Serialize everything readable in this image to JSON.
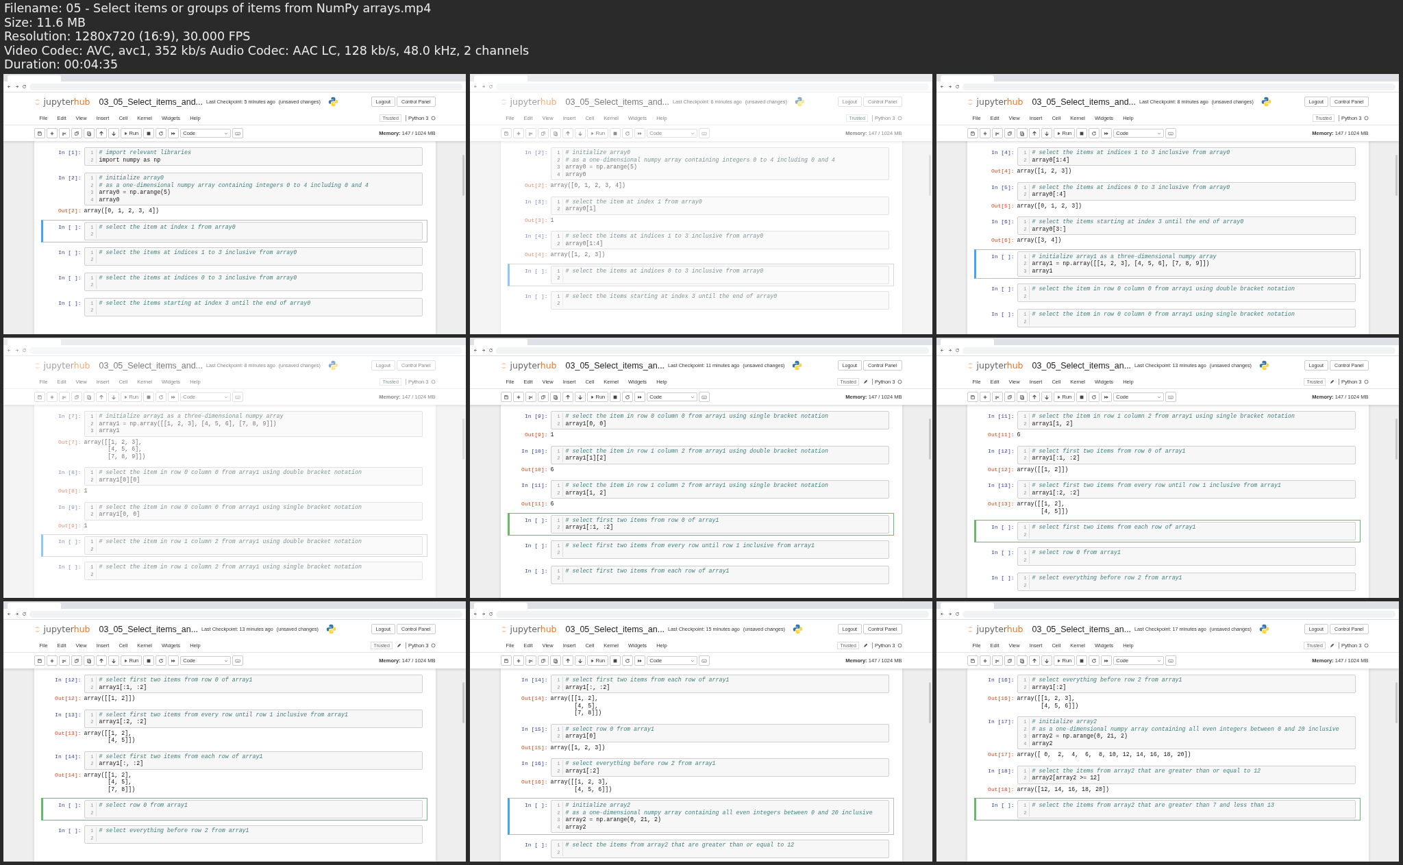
{
  "file_info": [
    "Filename: 05 - Select items or groups of items from NumPy arrays.mp4",
    "Size: 11.6 MB",
    "Resolution: 1280x720 (16:9), 30.000 FPS",
    "Video Codec: AVC, avc1, 352 kb/s Audio Codec: AAC LC, 128 kb/s, 48.0 kHz, 2 channels",
    "Duration: 00:04:35"
  ],
  "frames": [
    {
      "faded": false,
      "notebook_title": "03_05_Select_items_and...",
      "checkpoint": "Last Checkpoint: 5 minutes ago",
      "unsaved": "(unsaved changes)",
      "brand": [
        "jupyter",
        "hub"
      ],
      "buttons": [
        "Logout",
        "Control Panel"
      ],
      "menus": [
        "File",
        "Edit",
        "View",
        "Insert",
        "Cell",
        "Kernel",
        "Widgets",
        "Help"
      ],
      "trusted": "Trusted",
      "pencil": false,
      "kernel": "Python 3",
      "run": "Run",
      "cell_type": "Code",
      "memory": "**Memory:** 147 / 1024 MB",
      "cells": [
        {
          "prompt": "In [1]:",
          "line_numbers": [
            "1",
            "2"
          ],
          "lines": [
            "# import relevant libraries",
            "import numpy as np"
          ],
          "selected": false
        },
        {
          "prompt": "In [2]:",
          "line_numbers": [
            "1",
            "2",
            "3",
            "4"
          ],
          "lines": [
            "# initialize array0",
            "# as a one-dimensional numpy array containing integers 0 to 4 including 0 and 4",
            "array0 = np.arange(5)",
            "array0"
          ],
          "out_prompt": "Out[2]:",
          "output": [
            "array([0, 1, 2, 3, 4])"
          ],
          "selected": false
        },
        {
          "prompt": "In [ ]:",
          "line_numbers": [
            "1",
            "2"
          ],
          "lines": [
            "# select the item at index 1 from array0"
          ],
          "selected": true,
          "editing": false
        },
        {
          "prompt": "In [ ]:",
          "line_numbers": [
            "1",
            "2"
          ],
          "lines": [
            "# select the items at indices 1 to 3 inclusive from array0"
          ],
          "selected": false
        },
        {
          "prompt": "In [ ]:",
          "line_numbers": [
            "1",
            "2"
          ],
          "lines": [
            "# select the items at indices 0 to 3 inclusive from array0"
          ],
          "selected": false
        },
        {
          "prompt": "In [ ]:",
          "line_numbers": [
            "1",
            "2"
          ],
          "lines": [
            "# select the items starting at index 3 until the end of array0"
          ],
          "selected": false
        }
      ]
    },
    {
      "faded": true,
      "notebook_title": "03_05_Select_items_and...",
      "checkpoint": "Last Checkpoint: 6 minutes ago",
      "unsaved": "(unsaved changes)",
      "brand": [
        "jupyter",
        "hub"
      ],
      "buttons": [
        "Logout",
        "Control Panel"
      ],
      "menus": [
        "File",
        "Edit",
        "View",
        "Insert",
        "Cell",
        "Kernel",
        "Widgets",
        "Help"
      ],
      "trusted": "Trusted",
      "pencil": false,
      "kernel": "Python 3",
      "run": "Run",
      "cell_type": "Code",
      "memory": "**Memory:** 147 / 1024 MB",
      "cells": [
        {
          "prompt": "In [2]:",
          "line_numbers": [
            "1",
            "2",
            "3",
            "4"
          ],
          "lines": [
            "# initialize array0",
            "# as a one-dimensional numpy array containing integers 0 to 4 including 0 and 4",
            "array0 = np.arange(5)",
            "array0"
          ],
          "out_prompt": "Out[2]:",
          "output": [
            "array([0, 1, 2, 3, 4])"
          ],
          "selected": false
        },
        {
          "prompt": "In [3]:",
          "line_numbers": [
            "1",
            "2"
          ],
          "lines": [
            "# select the item at index 1 from array0",
            "array0[1]"
          ],
          "out_prompt": "Out[3]:",
          "output": [
            "1"
          ],
          "selected": false
        },
        {
          "prompt": "In [4]:",
          "line_numbers": [
            "1",
            "2"
          ],
          "lines": [
            "# select the items at indices 1 to 3 inclusive from array0",
            "array0[1:4]"
          ],
          "out_prompt": "Out[4]:",
          "output": [
            "array([1, 2, 3])"
          ],
          "selected": false
        },
        {
          "prompt": "In [ ]:",
          "line_numbers": [
            "1",
            "2"
          ],
          "lines": [
            "# select the items at indices 0 to 3 inclusive from array0"
          ],
          "selected": true,
          "editing": false
        },
        {
          "prompt": "In [ ]:",
          "line_numbers": [
            "1",
            "2"
          ],
          "lines": [
            "# select the items starting at index 3 until the end of array0"
          ],
          "selected": false
        }
      ]
    },
    {
      "faded": false,
      "notebook_title": "03_05_Select_items_and...",
      "checkpoint": "Last Checkpoint: 8 minutes ago",
      "unsaved": "(unsaved changes)",
      "brand": [
        "jupyter",
        "hub"
      ],
      "buttons": [
        "Logout",
        "Control Panel"
      ],
      "menus": [
        "File",
        "Edit",
        "View",
        "Insert",
        "Cell",
        "Kernel",
        "Widgets",
        "Help"
      ],
      "trusted": "Trusted",
      "pencil": false,
      "kernel": "Python 3",
      "run": "Run",
      "cell_type": "Code",
      "memory": "**Memory:** 147 / 1024 MB",
      "cells": [
        {
          "prompt": "In [4]:",
          "line_numbers": [
            "1",
            "2"
          ],
          "lines": [
            "# select the items at indices 1 to 3 inclusive from array0",
            "array0[1:4]"
          ],
          "out_prompt": "Out[4]:",
          "output": [
            "array([1, 2, 3])"
          ],
          "selected": false
        },
        {
          "prompt": "In [5]:",
          "line_numbers": [
            "1",
            "2"
          ],
          "lines": [
            "# select the items at indices 0 to 3 inclusive from array0",
            "array0[:4]"
          ],
          "out_prompt": "Out[5]:",
          "output": [
            "array([0, 1, 2, 3])"
          ],
          "selected": false
        },
        {
          "prompt": "In [6]:",
          "line_numbers": [
            "1",
            "2"
          ],
          "lines": [
            "# select the items starting at index 3 until the end of array0",
            "array0[3:]"
          ],
          "out_prompt": "Out[6]:",
          "output": [
            "array([3, 4])"
          ],
          "selected": false
        },
        {
          "prompt": "In [ ]:",
          "line_numbers": [
            "1",
            "2",
            "3"
          ],
          "lines": [
            "# initialize array1 as a three-dimensional numpy array",
            "array1 = np.array([[1, 2, 3], [4, 5, 6], [7, 8, 9]])",
            "array1"
          ],
          "selected": true,
          "editing": false
        },
        {
          "prompt": "In [ ]:",
          "line_numbers": [
            "1",
            "2"
          ],
          "lines": [
            "# select the item in row 0 column 0 from array1 using double bracket notation"
          ],
          "selected": false
        },
        {
          "prompt": "In [ ]:",
          "line_numbers": [
            "1",
            "2"
          ],
          "lines": [
            "# select the item in row 0 column 0 from array1 using single bracket notation"
          ],
          "selected": false
        }
      ]
    },
    {
      "faded": true,
      "notebook_title": "03_05_Select_items_and...",
      "checkpoint": "Last Checkpoint: 8 minutes ago",
      "unsaved": "(unsaved changes)",
      "brand": [
        "jupyter",
        "hub"
      ],
      "buttons": [
        "Logout",
        "Control Panel"
      ],
      "menus": [
        "File",
        "Edit",
        "View",
        "Insert",
        "Cell",
        "Kernel",
        "Widgets",
        "Help"
      ],
      "trusted": "Trusted",
      "pencil": false,
      "kernel": "Python 3",
      "run": "Run",
      "cell_type": "Code",
      "memory": "**Memory:** 147 / 1024 MB",
      "cells": [
        {
          "prompt": "In [7]:",
          "line_numbers": [
            "1",
            "2",
            "3"
          ],
          "lines": [
            "# initialize array1 as a three-dimensional numpy array",
            "array1 = np.array([[1, 2, 3], [4, 5, 6], [7, 8, 9]])",
            "array1"
          ],
          "out_prompt": "Out[7]:",
          "output": [
            "array([[1, 2, 3],",
            "       [4, 5, 6],",
            "       [7, 8, 9]])"
          ],
          "selected": false
        },
        {
          "prompt": "In [8]:",
          "line_numbers": [
            "1",
            "2"
          ],
          "lines": [
            "# select the item in row 0 column 0 from array1 using double bracket notation",
            "array1[0][0]"
          ],
          "out_prompt": "Out[8]:",
          "output": [
            "1"
          ],
          "selected": false
        },
        {
          "prompt": "In [9]:",
          "line_numbers": [
            "1",
            "2"
          ],
          "lines": [
            "# select the item in row 0 column 0 from array1 using single bracket notation",
            "array1[0, 0]"
          ],
          "out_prompt": "Out[9]:",
          "output": [
            "1"
          ],
          "selected": false
        },
        {
          "prompt": "In [ ]:",
          "line_numbers": [
            "1",
            "2"
          ],
          "lines": [
            "# select the item in row 1 column 2 from array1 using double bracket notation"
          ],
          "selected": true,
          "editing": false
        },
        {
          "prompt": "In [ ]:",
          "line_numbers": [
            "1",
            "2"
          ],
          "lines": [
            "# select the item in row 1 column 2 from array1 using single bracket notation"
          ],
          "selected": false
        }
      ]
    },
    {
      "faded": false,
      "notebook_title": "03_05_Select_items_an...",
      "checkpoint": "Last Checkpoint: 11 minutes ago",
      "unsaved": "(unsaved changes)",
      "brand": [
        "jupyter",
        "hub"
      ],
      "buttons": [
        "Logout",
        "Control Panel"
      ],
      "menus": [
        "File",
        "Edit",
        "View",
        "Insert",
        "Cell",
        "Kernel",
        "Widgets",
        "Help"
      ],
      "trusted": "Trusted",
      "pencil": true,
      "kernel": "Python 3",
      "run": "Run",
      "cell_type": "Code",
      "memory": "**Memory:** 147 / 1024 MB",
      "cells": [
        {
          "prompt": "In [9]:",
          "line_numbers": [
            "1",
            "2"
          ],
          "lines": [
            "# select the item in row 0 column 0 from array1 using single bracket notation",
            "array1[0, 0]"
          ],
          "out_prompt": "Out[9]:",
          "output": [
            "1"
          ],
          "selected": false
        },
        {
          "prompt": "In [10]:",
          "line_numbers": [
            "1",
            "2"
          ],
          "lines": [
            "# select the item in row 1 column 2 from array1 using double bracket notation",
            "array1[1][2]"
          ],
          "out_prompt": "Out[10]:",
          "output": [
            "6"
          ],
          "selected": false
        },
        {
          "prompt": "In [11]:",
          "line_numbers": [
            "1",
            "2"
          ],
          "lines": [
            "# select the item in row 1 column 2 from array1 using single bracket notation",
            "array1[1, 2]"
          ],
          "out_prompt": "Out[11]:",
          "output": [
            "6"
          ],
          "selected": false
        },
        {
          "prompt": "In [ ]:",
          "line_numbers": [
            "1",
            "2"
          ],
          "lines": [
            "# select first two items from row 0 of array1",
            "array1[:1, :2]"
          ],
          "selected": true,
          "editing": true
        },
        {
          "prompt": "In [ ]:",
          "line_numbers": [
            "1",
            "2"
          ],
          "lines": [
            "# select first two items from every row until row 1 inclusive from array1"
          ],
          "selected": false
        },
        {
          "prompt": "In [ ]:",
          "line_numbers": [
            "1",
            "2"
          ],
          "lines": [
            "# select first two items from each row of array1"
          ],
          "selected": false
        }
      ]
    },
    {
      "faded": false,
      "notebook_title": "03_05_Select_items_an...",
      "checkpoint": "Last Checkpoint: 13 minutes ago",
      "unsaved": "(unsaved changes)",
      "brand": [
        "jupyter",
        "hub"
      ],
      "buttons": [
        "Logout",
        "Control Panel"
      ],
      "menus": [
        "File",
        "Edit",
        "View",
        "Insert",
        "Cell",
        "Kernel",
        "Widgets",
        "Help"
      ],
      "trusted": "Trusted",
      "pencil": true,
      "kernel": "Python 3",
      "run": "Run",
      "cell_type": "Code",
      "memory": "**Memory:** 147 / 1024 MB",
      "cells": [
        {
          "prompt": "In [11]:",
          "line_numbers": [
            "1",
            "2"
          ],
          "lines": [
            "# select the item in row 1 column 2 from array1 using single bracket notation",
            "array1[1, 2]"
          ],
          "out_prompt": "Out[11]:",
          "output": [
            "6"
          ],
          "selected": false
        },
        {
          "prompt": "In [12]:",
          "line_numbers": [
            "1",
            "2"
          ],
          "lines": [
            "# select first two items from row 0 of array1",
            "array1[:1, :2]"
          ],
          "out_prompt": "Out[12]:",
          "output": [
            "array([[1, 2]])"
          ],
          "selected": false
        },
        {
          "prompt": "In [13]:",
          "line_numbers": [
            "1",
            "2"
          ],
          "lines": [
            "# select first two items from every row until row 1 inclusive from array1",
            "array1[:2, :2]"
          ],
          "out_prompt": "Out[13]:",
          "output": [
            "array([[1, 2],",
            "       [4, 5]])"
          ],
          "selected": false
        },
        {
          "prompt": "In [ ]:",
          "line_numbers": [
            "1",
            "2"
          ],
          "lines": [
            "# select first two items from each row of array1"
          ],
          "selected": true,
          "editing": true
        },
        {
          "prompt": "In [ ]:",
          "line_numbers": [
            "1",
            "2"
          ],
          "lines": [
            "# select row 0 from array1"
          ],
          "selected": false
        },
        {
          "prompt": "In [ ]:",
          "line_numbers": [
            "1",
            "2"
          ],
          "lines": [
            "# select everything before row 2 from array1"
          ],
          "selected": false
        }
      ]
    },
    {
      "faded": false,
      "notebook_title": "03_05_Select_items_an...",
      "checkpoint": "Last Checkpoint: 13 minutes ago",
      "unsaved": "(unsaved changes)",
      "brand": [
        "jupyter",
        "hub"
      ],
      "buttons": [
        "Logout",
        "Control Panel"
      ],
      "menus": [
        "File",
        "Edit",
        "View",
        "Insert",
        "Cell",
        "Kernel",
        "Widgets",
        "Help"
      ],
      "trusted": "Trusted",
      "pencil": true,
      "kernel": "Python 3",
      "run": "Run",
      "cell_type": "Code",
      "memory": "**Memory:** 147 / 1024 MB",
      "cells": [
        {
          "prompt": "In [12]:",
          "line_numbers": [
            "1",
            "2"
          ],
          "lines": [
            "# select first two items from row 0 of array1",
            "array1[:1, :2]"
          ],
          "out_prompt": "Out[12]:",
          "output": [
            "array([[1, 2]])"
          ],
          "selected": false
        },
        {
          "prompt": "In [13]:",
          "line_numbers": [
            "1",
            "2"
          ],
          "lines": [
            "# select first two items from every row until row 1 inclusive from array1",
            "array1[:2, :2]"
          ],
          "out_prompt": "Out[13]:",
          "output": [
            "array([[1, 2],",
            "       [4, 5]])"
          ],
          "selected": false
        },
        {
          "prompt": "In [14]:",
          "line_numbers": [
            "1",
            "2"
          ],
          "lines": [
            "# select first two items from each row of array1",
            "array1[:, :2]"
          ],
          "out_prompt": "Out[14]:",
          "output": [
            "array([[1, 2],",
            "       [4, 5],",
            "       [7, 8]])"
          ],
          "selected": false
        },
        {
          "prompt": "In [ ]:",
          "line_numbers": [
            "1",
            "2"
          ],
          "lines": [
            "# select row 0 from array1"
          ],
          "selected": true,
          "editing": true
        },
        {
          "prompt": "In [ ]:",
          "line_numbers": [
            "1",
            "2"
          ],
          "lines": [
            "# select everything before row 2 from array1"
          ],
          "selected": false
        }
      ]
    },
    {
      "faded": false,
      "notebook_title": "03_05_Select_items_an...",
      "checkpoint": "Last Checkpoint: 15 minutes ago",
      "unsaved": "(unsaved changes)",
      "brand": [
        "jupyter",
        "hub"
      ],
      "buttons": [
        "Logout",
        "Control Panel"
      ],
      "menus": [
        "File",
        "Edit",
        "View",
        "Insert",
        "Cell",
        "Kernel",
        "Widgets",
        "Help"
      ],
      "trusted": "Trusted",
      "pencil": true,
      "kernel": "Python 3",
      "run": "Run",
      "cell_type": "Code",
      "memory": "**Memory:** 147 / 1024 MB",
      "cells": [
        {
          "prompt": "In [14]:",
          "line_numbers": [
            "1",
            "2"
          ],
          "lines": [
            "# select first two items from each row of array1",
            "array1[:, :2]"
          ],
          "out_prompt": "Out[14]:",
          "output": [
            "array([[1, 2],",
            "       [4, 5],",
            "       [7, 8]])"
          ],
          "selected": false
        },
        {
          "prompt": "In [15]:",
          "line_numbers": [
            "1",
            "2"
          ],
          "lines": [
            "# select row 0 from array1",
            "array1[0]"
          ],
          "out_prompt": "Out[15]:",
          "output": [
            "array([1, 2, 3])"
          ],
          "selected": false
        },
        {
          "prompt": "In [16]:",
          "line_numbers": [
            "1",
            "2"
          ],
          "lines": [
            "# select everything before row 2 from array1",
            "array1[:2]"
          ],
          "out_prompt": "Out[16]:",
          "output": [
            "array([[1, 2, 3],",
            "       [4, 5, 6]])"
          ],
          "selected": false
        },
        {
          "prompt": "In [ ]:",
          "line_numbers": [
            "1",
            "2",
            "3",
            "4"
          ],
          "lines": [
            "# initialize array2",
            "# as a one-dimensional numpy array containing all even integers between 0 and 20 inclusive",
            "array2 = np.arange(0, 21, 2)",
            "array2"
          ],
          "selected": true,
          "editing": false
        },
        {
          "prompt": "In [ ]:",
          "line_numbers": [
            "1",
            "2"
          ],
          "lines": [
            "# select the items from array2 that are greater than or equal to 12"
          ],
          "selected": false
        }
      ]
    },
    {
      "faded": false,
      "notebook_title": "03_05_Select_items_an...",
      "checkpoint": "Last Checkpoint: 17 minutes ago",
      "unsaved": "(unsaved changes)",
      "brand": [
        "jupyter",
        "hub"
      ],
      "buttons": [
        "Logout",
        "Control Panel"
      ],
      "menus": [
        "File",
        "Edit",
        "View",
        "Insert",
        "Cell",
        "Kernel",
        "Widgets",
        "Help"
      ],
      "trusted": "Trusted",
      "pencil": true,
      "kernel": "Python 3",
      "run": "Run",
      "cell_type": "Code",
      "memory": "**Memory:** 147 / 1024 MB",
      "cells": [
        {
          "prompt": "In [16]:",
          "line_numbers": [
            "1",
            "2"
          ],
          "lines": [
            "# select everything before row 2 from array1",
            "array1[:2]"
          ],
          "out_prompt": "Out[16]:",
          "output": [
            "array([[1, 2, 3],",
            "       [4, 5, 6]])"
          ],
          "selected": false
        },
        {
          "prompt": "In [17]:",
          "line_numbers": [
            "1",
            "2",
            "3",
            "4"
          ],
          "lines": [
            "# initialize array2",
            "# as a one-dimensional numpy array containing all even integers between 0 and 20 inclusive",
            "array2 = np.arange(0, 21, 2)",
            "array2"
          ],
          "out_prompt": "Out[17]:",
          "output": [
            "array([ 0,  2,  4,  6,  8, 10, 12, 14, 16, 18, 20])"
          ],
          "selected": false
        },
        {
          "prompt": "In [18]:",
          "line_numbers": [
            "1",
            "2"
          ],
          "lines": [
            "# select the items from array2 that are greater than or equal to 12",
            "array2[array2 >= 12]"
          ],
          "out_prompt": "Out[18]:",
          "output": [
            "array([12, 14, 16, 18, 20])"
          ],
          "selected": false
        },
        {
          "prompt": "In [ ]:",
          "line_numbers": [
            "1",
            "2"
          ],
          "lines": [
            "# select the items from array2 that are greater than 7 and less than 13"
          ],
          "selected": true,
          "editing": true
        }
      ]
    }
  ]
}
